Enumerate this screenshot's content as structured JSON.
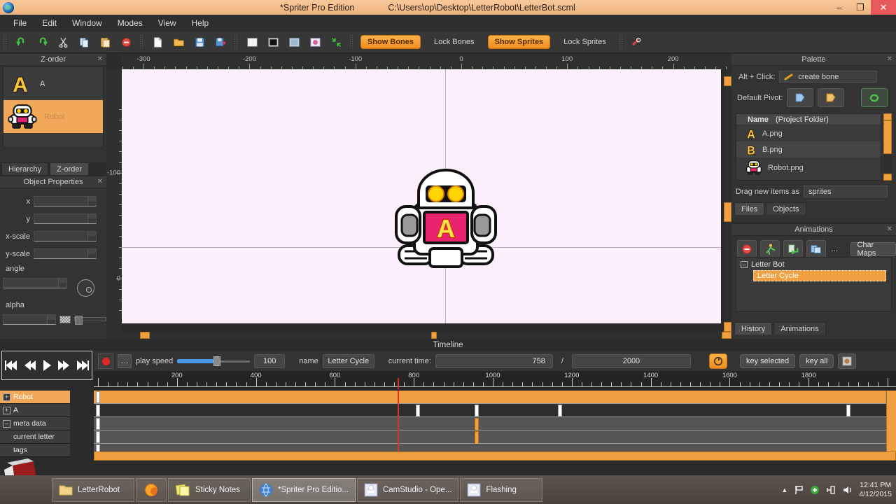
{
  "titlebar": {
    "app_name": "*Spriter Pro Edition",
    "file_path": "C:\\Users\\op\\Desktop\\LetterRobot\\LetterBot.scml",
    "minimize": "–",
    "maximize": "❐",
    "close": "✕",
    "app_icon": "globe-icon"
  },
  "menubar": {
    "items": [
      "File",
      "Edit",
      "Window",
      "Modes",
      "View",
      "Help"
    ]
  },
  "toolbar": {
    "icons": [
      "undo-icon",
      "redo-icon",
      "cut-icon",
      "copy-icon",
      "paste-icon",
      "delete-icon",
      "new-file-icon",
      "open-folder-icon",
      "save-icon",
      "save-as-icon",
      "white-square-icon",
      "black-square-icon",
      "blue-square-icon",
      "image-square-icon",
      "collapse-icon"
    ],
    "toggles": [
      {
        "label": "Show Bones",
        "state": "on"
      },
      {
        "label": "Lock Bones",
        "state": "off"
      },
      {
        "label": "Show Sprites",
        "state": "on"
      },
      {
        "label": "Lock Sprites",
        "state": "off"
      }
    ],
    "last_icon": "bone-icon"
  },
  "zorder_panel": {
    "title": "Z-order",
    "close": "✕",
    "items": [
      {
        "label": "A",
        "icon": "letter-a-sprite",
        "selected": false
      },
      {
        "label": "Robot",
        "icon": "robot-sprite",
        "selected": true
      }
    ],
    "tabs": [
      {
        "label": "Hierarchy",
        "active": false
      },
      {
        "label": "Z-order",
        "active": true
      }
    ]
  },
  "object_properties": {
    "title": "Object Properties",
    "close": "✕",
    "fields": [
      {
        "label": "x",
        "value": ""
      },
      {
        "label": "y",
        "value": ""
      },
      {
        "label": "x-scale",
        "value": ""
      },
      {
        "label": "y-scale",
        "value": ""
      }
    ],
    "angle_label": "angle",
    "angle_value": "",
    "alpha_label": "alpha",
    "alpha_value": ""
  },
  "canvas": {
    "ruler_top_labels": [
      "-300",
      "-200",
      "-100",
      "0",
      "100",
      "200"
    ],
    "ruler_left_labels": [
      "-100",
      "0"
    ],
    "sprite": {
      "name": "robot-sprite",
      "body_color": "#ffffff",
      "visor_color": "#111111",
      "eye_color": "#ffd400",
      "screen_color": "#e8246e",
      "letter": "A",
      "letter_color": "#ffd400"
    },
    "bg_color": "#fbf0fb",
    "guide_color": "#b9a9c4"
  },
  "palette": {
    "title": "Palette",
    "close": "✕",
    "alt_click_label": "Alt + Click:",
    "alt_click_value": "create bone",
    "alt_click_icon": "bone-icon",
    "default_pivot_label": "Default Pivot:",
    "pivot_buttons": [
      "pivot-blue-icon",
      "pivot-orange-icon",
      "refresh-green-icon"
    ],
    "list_header": {
      "name": "Name",
      "folder": "(Project Folder)",
      "sort": "▲"
    },
    "files": [
      {
        "label": "A.png",
        "icon": "letter-a-sprite"
      },
      {
        "label": "B.png",
        "icon": "letter-b-sprite"
      },
      {
        "label": "Robot.png",
        "icon": "robot-sprite"
      }
    ],
    "drag_label": "Drag new items as",
    "drag_value": "sprites",
    "tabs": [
      {
        "label": "Files",
        "active": true
      },
      {
        "label": "Objects",
        "active": false
      }
    ]
  },
  "animations": {
    "title": "Animations",
    "close": "✕",
    "buttons": [
      "delete-red-icon",
      "run-person-icon",
      "add-anim-icon",
      "copy-anim-icon",
      "more-icon"
    ],
    "char_maps_label": "Char Maps",
    "tree": {
      "root": "Letter Bot",
      "expander": "–",
      "children": [
        {
          "label": "Letter Cycle",
          "selected": true
        }
      ]
    },
    "tabs": [
      {
        "label": "History",
        "active": true
      },
      {
        "label": "Animations",
        "active": false
      }
    ]
  },
  "timeline": {
    "title": "Timeline",
    "transport": [
      "skip-back-icon",
      "rewind-icon",
      "play-icon",
      "fast-forward-icon",
      "skip-forward-icon"
    ],
    "record_icon": "record-icon",
    "more_icon": "more-icon",
    "play_speed_label": "play speed",
    "play_speed_value": "100",
    "name_label": "name",
    "name_value": "Letter Cycle",
    "current_time_label": "current time:",
    "current_time_value": "758",
    "separator": "/",
    "total_time_value": "2000",
    "loop_icon": "loop-icon",
    "key_selected_label": "key selected",
    "key_all_label": "key all",
    "onion_icon": "onion-skin-icon",
    "ruler_labels": [
      200,
      400,
      600,
      800,
      1000,
      1200,
      1400,
      1600,
      1800
    ],
    "ruler_max": 2000,
    "playhead_time": 758,
    "tracks": [
      {
        "label": "Robot",
        "expander": "+",
        "selected": true,
        "type": "band-orange",
        "keys": [
          0,
          2000
        ]
      },
      {
        "label": "A",
        "expander": "+",
        "selected": false,
        "type": "dark",
        "keys": [
          0,
          810,
          960,
          1170,
          1900
        ]
      },
      {
        "label": "meta data",
        "expander": "–",
        "selected": false,
        "type": "mid",
        "keys": [
          0,
          960
        ]
      },
      {
        "label": "current letter",
        "expander": "",
        "selected": false,
        "type": "mid",
        "keys": [
          0,
          960
        ]
      },
      {
        "label": "tags",
        "expander": "",
        "selected": false,
        "type": "mid",
        "keys": [
          0
        ]
      }
    ]
  },
  "taskbar": {
    "items": [
      {
        "label": "LetterRobot",
        "icon": "folder-icon",
        "active": false
      },
      {
        "label": "",
        "icon": "firefox-icon",
        "active": false,
        "narrow": true
      },
      {
        "label": "Sticky Notes",
        "icon": "notes-icon",
        "active": false
      },
      {
        "label": "*Spriter Pro Editio...",
        "icon": "globe-icon",
        "active": true
      },
      {
        "label": "CamStudio - Ope...",
        "icon": "camera-icon",
        "active": false
      },
      {
        "label": "Flashing",
        "icon": "camera-icon",
        "active": false
      }
    ],
    "tray_icons": [
      "show-hidden-icon",
      "flag-icon",
      "sync-icon",
      "network-icon",
      "volume-icon"
    ],
    "clock_time": "12:41 PM",
    "clock_date": "4/12/2015"
  },
  "colors": {
    "accent_orange": "#f0a040",
    "title_peach": "#f3bd8b",
    "panel_bg": "#333333",
    "playhead_red": "#e03030"
  }
}
